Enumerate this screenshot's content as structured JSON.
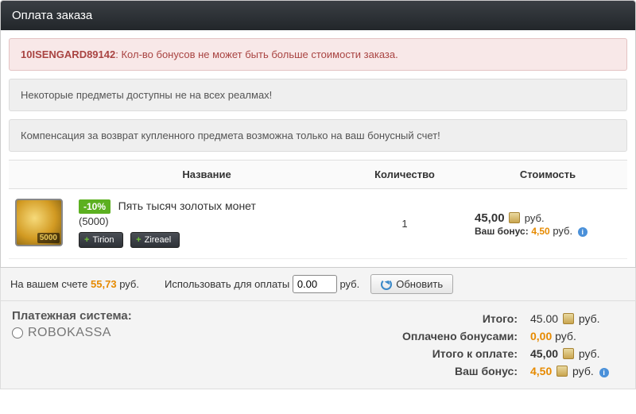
{
  "header": {
    "title": "Оплата заказа"
  },
  "alerts": {
    "error_code": "10ISENGARD89142",
    "error_sep": ": ",
    "error_text": "Кол-во бонусов не может быть больше стоимости заказа.",
    "note_realms": "Некоторые предметы доступны не на всех реалмах!",
    "note_refund": "Компенсация за возврат купленного предмета возможна только на ваш бонусный счет!"
  },
  "table": {
    "head": {
      "name": "Название",
      "qty": "Количество",
      "cost": "Стоимость"
    },
    "item": {
      "badge": "5000",
      "discount": "-10%",
      "title": "Пять тысяч золотых монет",
      "subtitle": "(5000)",
      "tags": [
        "Tirion",
        "Zireael"
      ],
      "qty": "1",
      "price": "45,00",
      "currency": "руб.",
      "bonus_label": "Ваш бонус:",
      "bonus_value": "4,50"
    }
  },
  "footer": {
    "balance_label": "На вашем счете",
    "balance_value": "55,73",
    "balance_currency": "руб.",
    "use_label": "Использовать для оплаты",
    "use_value": "0.00",
    "use_currency": "руб.",
    "refresh": "Обновить"
  },
  "summary": {
    "paysys_label": "Платежная система:",
    "paysys_name": "ROBOKASSA",
    "rows": {
      "total_lbl": "Итого:",
      "total_val": "45.00",
      "paid_bonus_lbl": "Оплачено бонусами:",
      "paid_bonus_val": "0,00",
      "to_pay_lbl": "Итого к оплате:",
      "to_pay_val": "45,00",
      "your_bonus_lbl": "Ваш бонус:",
      "your_bonus_val": "4,50",
      "currency": "руб."
    }
  }
}
